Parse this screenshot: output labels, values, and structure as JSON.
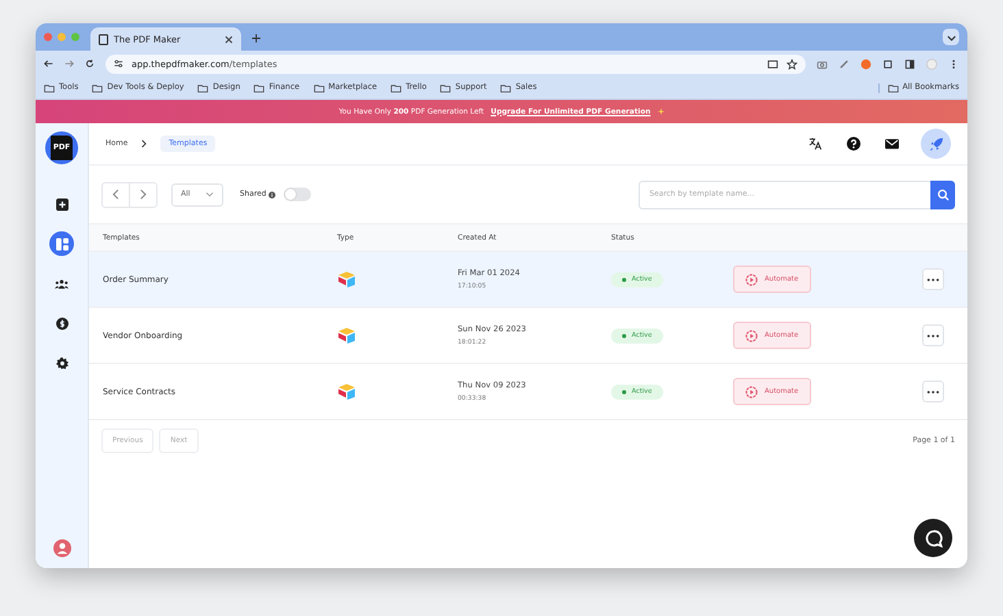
{
  "browser": {
    "tab_title": "The PDF Maker",
    "url_host": "app.thepdfmaker.com",
    "url_path": "/templates",
    "bookmarks": [
      "Tools",
      "Dev Tools & Deploy",
      "Design",
      "Finance",
      "Marketplace",
      "Trello",
      "Support",
      "Sales"
    ],
    "all_bookmarks": "All Bookmarks"
  },
  "banner": {
    "text": "You Have Only **200** PDF Generation Left",
    "link": "Upgrade For Unlimited PDF Generation"
  },
  "sidebar": {
    "logo": "PDF",
    "items": [
      {
        "kind": "add",
        "selected": false
      },
      {
        "kind": "templates",
        "selected": true
      },
      {
        "kind": "team",
        "selected": false
      },
      {
        "kind": "billing",
        "selected": false
      },
      {
        "kind": "settings",
        "selected": false
      }
    ]
  },
  "breadcrumb": {
    "home": "Home",
    "current": "Templates"
  },
  "toolbar": {
    "filter": "All",
    "shared_label": "Shared",
    "shared_on": false,
    "search_placeholder": "Search by template name..."
  },
  "table": {
    "columns": [
      "Templates",
      "Type",
      "Created At",
      "Status"
    ],
    "rows": [
      {
        "name": "Order Summary",
        "date": "Fri Mar 01 2024",
        "time": "17:10:05",
        "status": "Active",
        "action": "Automate",
        "selected": true
      },
      {
        "name": "Vendor Onboarding",
        "date": "Sun Nov 26 2023",
        "time": "18:01:22",
        "status": "Active",
        "action": "Automate",
        "selected": false
      },
      {
        "name": "Service Contracts",
        "date": "Thu Nov 09 2023",
        "time": "00:33:38",
        "status": "Active",
        "action": "Automate",
        "selected": false
      }
    ]
  },
  "pagination": {
    "previous": "Previous",
    "next": "Next",
    "page": "Page 1 of 1"
  }
}
